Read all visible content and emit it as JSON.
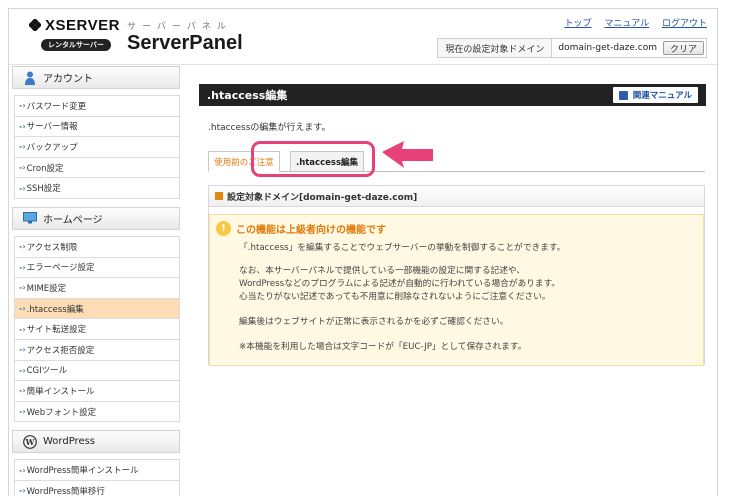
{
  "header": {
    "logo_brand": "XSERVER",
    "logo_rental": "レンタルサーバー",
    "logo_sub": "サーバーパネル",
    "logo_product": "ServerPanel",
    "links": [
      "トップ",
      "マニュアル",
      "ログアウト"
    ],
    "domain_label": "現在の設定対象ドメイン",
    "domain_value": "domain-get-daze.com",
    "clear_label": "クリア"
  },
  "sidebar": {
    "sections": [
      {
        "title": "アカウント",
        "icon": "user-icon",
        "items": [
          "パスワード変更",
          "サーバー情報",
          "バックアップ",
          "Cron設定",
          "SSH設定"
        ]
      },
      {
        "title": "ホームページ",
        "icon": "monitor-icon",
        "items": [
          "アクセス制限",
          "エラーページ設定",
          "MIME設定",
          ".htaccess編集",
          "サイト転送設定",
          "アクセス拒否設定",
          "CGIツール",
          "簡単インストール",
          "Webフォント設定"
        ]
      },
      {
        "title": "WordPress",
        "icon": "wordpress-icon",
        "items": [
          "WordPress簡単インストール",
          "WordPress簡単移行"
        ]
      }
    ],
    "active_item": ".htaccess編集"
  },
  "main": {
    "title": ".htaccess編集",
    "manual_button": "関連マニュアル",
    "description": ".htaccessの編集が行えます。",
    "tabs": [
      "使用前のご注意",
      ".htaccess編集"
    ],
    "panel_title": "設定対象ドメイン[domain-get-daze.com]",
    "notice_title": "この機能は上級者向けの機能です",
    "notice_lines": [
      "「.htaccess」を編集することでウェブサーバーの挙動を制御することができます。",
      "なお、本サーバーパネルで提供している一部機能の設定に関する記述や、",
      "WordPressなどのプログラムによる記述が自動的に行われている場合があります。",
      "心当たりがない記述であっても不用意に削除なされないようにご注意ください。",
      "編集後はウェブサイトが正常に表示されるかを必ずご確認ください。",
      "※本機能を利用した場合は文字コードが「EUC-JP」として保存されます。"
    ]
  },
  "colors": {
    "accent_orange": "#e07b0c",
    "active_menu": "#fcdcb4",
    "highlight": "#e8417a",
    "link_blue": "#1f56a5"
  }
}
